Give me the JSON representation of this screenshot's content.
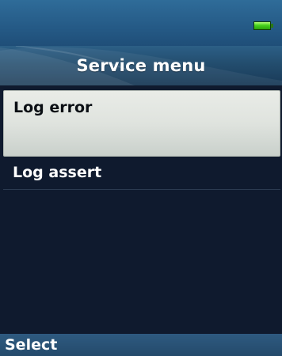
{
  "status_bar": {
    "battery_icon": "battery-full-icon",
    "battery_color": "#46d11b"
  },
  "title_bar": {
    "title": "Service menu"
  },
  "menu": {
    "items": [
      {
        "label": "Log error",
        "selected": true
      },
      {
        "label": "Log assert",
        "selected": false
      }
    ]
  },
  "softkeys": {
    "left": "Select"
  },
  "colors": {
    "accent": "#2f6c99",
    "background": "#0f1a2e",
    "selection": "#dfe3de"
  }
}
